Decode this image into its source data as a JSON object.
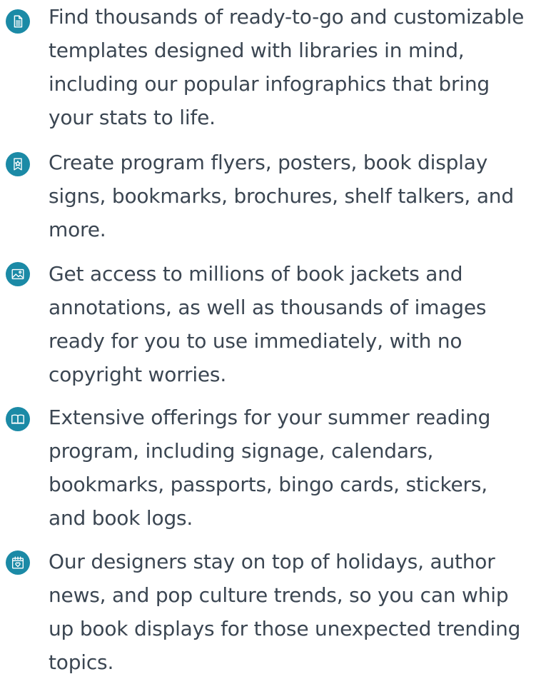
{
  "accent_color": "#1b8aa6",
  "features": [
    {
      "icon": "document-icon",
      "text": "Find thousands of ready-to-go and customizable templates designed with libraries in mind, including our popular infographics that bring your stats to life."
    },
    {
      "icon": "star-ribbon-icon",
      "text": "Create program flyers, posters, book display signs, bookmarks, brochures, shelf talkers, and more."
    },
    {
      "icon": "image-icon",
      "text": "Get access to millions of book jackets and annotations, as well as thousands of images ready for you to use immediately, with no copyright worries."
    },
    {
      "icon": "open-book-icon",
      "text": "Extensive offerings for your summer reading program, including signage, calendars, bookmarks, passports, bingo cards, stickers, and book logs."
    },
    {
      "icon": "calendar-heart-icon",
      "text": "Our designers stay on top of holidays, author news, and pop culture trends, so you can whip up book displays for those unexpected trending topics."
    }
  ]
}
